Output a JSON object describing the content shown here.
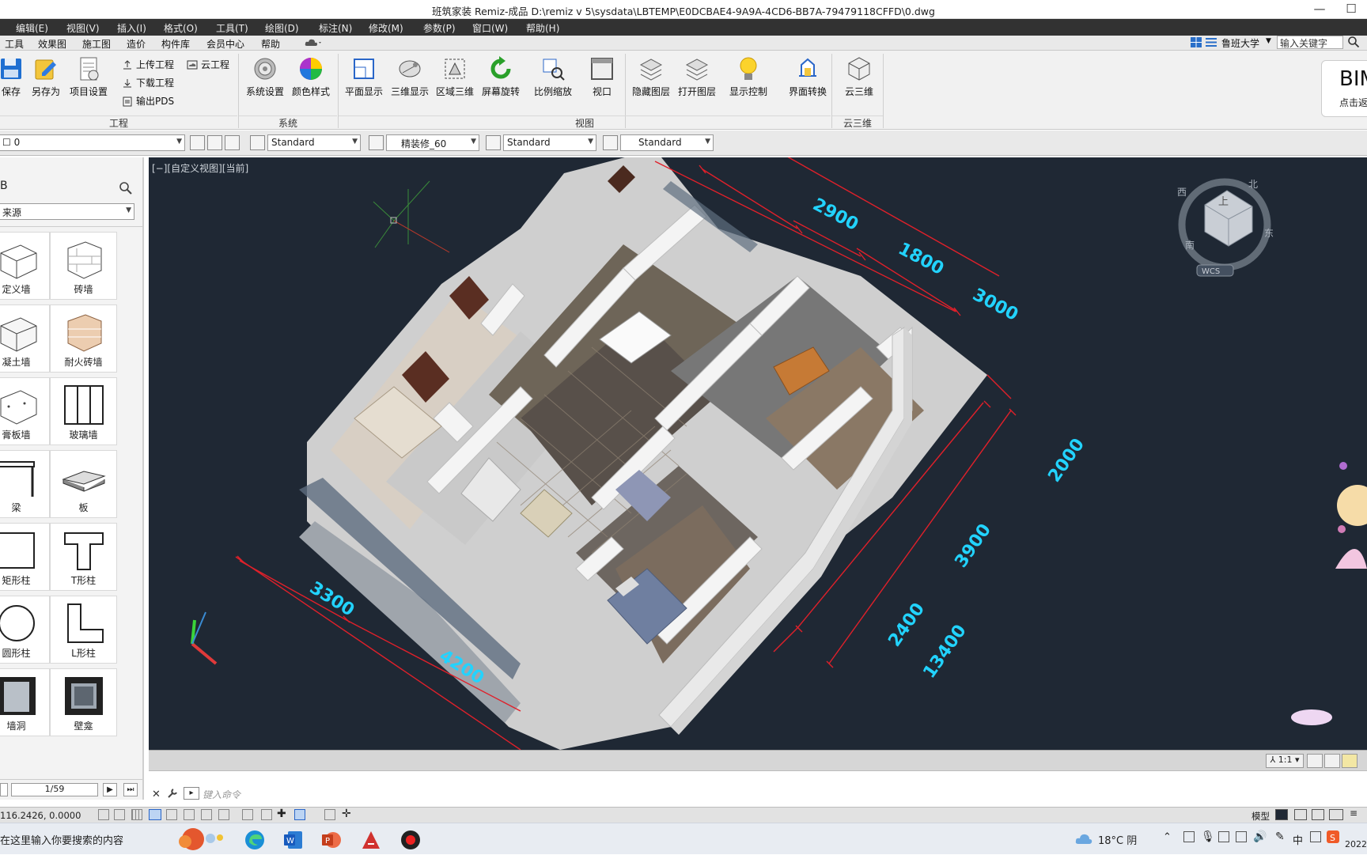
{
  "window": {
    "title": "班筑家装 Remiz-成品     D:\\remiz v 5\\sysdata\\LBTEMP\\E0DCBAE4-9A9A-4CD6-BB7A-79479118CFFD\\0.dwg",
    "minimize": "—",
    "maximize": "☐"
  },
  "menubar": [
    "编辑(E)",
    "视图(V)",
    "插入(I)",
    "格式(O)",
    "工具(T)",
    "绘图(D)",
    "标注(N)",
    "修改(M)",
    "参数(P)",
    "窗口(W)",
    "帮助(H)"
  ],
  "ribbon_tabs": [
    "工具",
    "效果图",
    "施工图",
    "造价",
    "构件库",
    "会员中心",
    "帮助"
  ],
  "ribbon_tab_icon": "cloud-icon",
  "top_right": {
    "user": "鲁班大学",
    "search_placeholder": "输入关键字",
    "banner_title": "BIM",
    "banner_sub": "点击返"
  },
  "ribbon": {
    "project": {
      "label": "工程",
      "save": "保存",
      "save_as": "另存为",
      "project_settings": "项目设置",
      "upload": "上传工程",
      "cloud_project": "云工程",
      "download": "下载工程",
      "export_pds": "输出PDS"
    },
    "system": {
      "label": "系统",
      "settings": "系统设置",
      "color_style": "颜色样式"
    },
    "view": {
      "label": "视图",
      "plan": "平面显示",
      "three_d": "三维显示",
      "area_3d": "区域三维",
      "rotate": "屏幕旋转",
      "zoom": "比例缩放",
      "viewport": "视口",
      "hide_layer": "隐藏图层",
      "open_layer": "打开图层",
      "display_ctrl": "显示控制",
      "ui_switch": "界面转换"
    },
    "cloud3d": {
      "label": "云三维",
      "button": "云三维"
    }
  },
  "propbar": {
    "layer": "0",
    "text_style": "Standard",
    "dim_style": "精装修_60",
    "table_style": "Standard",
    "multileader_style": "Standard"
  },
  "left_panel": {
    "title": "B",
    "source_select": "来源",
    "tiles": [
      "定义墙",
      "砖墙",
      "凝土墙",
      "耐火砖墙",
      "膏板墙",
      "玻璃墙",
      "梁",
      "板",
      "矩形柱",
      "T形柱",
      "圆形柱",
      "L形柱",
      "墙洞",
      "壁龛"
    ],
    "page": "1/59"
  },
  "viewport": {
    "view_label": "[−][自定义视图][当前]",
    "dimensions": [
      "2900",
      "1800",
      "3000",
      "2000",
      "3900",
      "2400",
      "13400",
      "3300",
      "4200"
    ],
    "viewcube": {
      "top": "上",
      "north": "北",
      "west": "西",
      "south": "南",
      "east": "东",
      "wcs": "WCS"
    },
    "scale": "1:1"
  },
  "command": {
    "placeholder": "键入命令"
  },
  "status": {
    "coords": "116.2426, 0.0000",
    "model": "模型"
  },
  "taskbar": {
    "search": "在这里输入你要搜索的内容",
    "weather": "18°C 阴",
    "ime": "中",
    "year": "2022"
  },
  "colors": {
    "viewport_bg": "#1f2834",
    "dim_text": "#22d3ff",
    "dim_line": "#e0202a",
    "menubar_bg": "#323232"
  }
}
